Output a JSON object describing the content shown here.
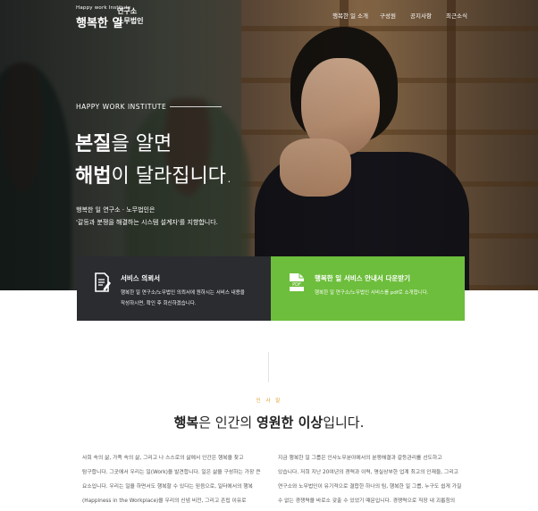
{
  "brand": {
    "tagline": "Happy work Institute",
    "name": "행복한 일",
    "sub1": "연구소",
    "sub2": "노무법인"
  },
  "nav": {
    "items": [
      {
        "label": "행복한 일 소개"
      },
      {
        "label": "구성원"
      },
      {
        "label": "공지사항"
      },
      {
        "label": "최근소식"
      }
    ]
  },
  "hero": {
    "eyebrow": "HAPPY WORK INSTITUTE",
    "headline1_bold": "본질",
    "headline1_rest": "을 알면",
    "headline2_bold": "해법",
    "headline2_rest": "이 달라집니다.",
    "desc1": "행복한 일 연구소 · 노무법인은",
    "desc2": "'갈등과 분쟁을 해결하는 시스템 설계자'를 지향합니다."
  },
  "cta": {
    "service": {
      "title": "서비스 의뢰서",
      "desc1": "행복한 일 연구소/노무법인 의뢰서에 원하시는 서비스 내용을",
      "desc2": "작성하시면, 확인 후 회신하겠습니다.",
      "icon": "document-pen-icon"
    },
    "download": {
      "title": "행복한 일 서비스 안내서 다운받기",
      "desc1": "행복한 일 연구소/노무법인 서비스를 pdf로 소개합니다.",
      "icon": "pdf-file-icon"
    }
  },
  "greeting": {
    "label": "인 사 말",
    "title_bold1": "행복",
    "title_mid": "은 인간의 ",
    "title_bold2": "영원한 이상",
    "title_end": "입니다.",
    "left_lines": [
      "사회 속의 삶, 가족 속의 삶, 그리고 나 스스로의 삶에서 인간은 행복을 찾고",
      "탐구합니다. 그곳에서 우리는 일(Work)을 발견합니다. 일은 삶을 구성하는 가장 큰",
      "요소입니다. 우리는 일을 하면서도 행복할 수 있다는 믿음으로, 일터에서의 행복",
      "(Happiness in the Workplace)을 우리의 신념 비전, 그리고 존립 이유로"
    ],
    "right_lines": [
      "지금 행복한 일 그룹은 인사노무분야에서의 분쟁해결과 갈등관리를 선도하고",
      "있습니다. 저희 지난 20여년의 경력과 이력, 명실상부한 업계 최고의 인재들, 그리고",
      "연구소와 노무법인이 유기적으로 결합한 하나의 팀, 행복한 일 그룹, 누구도 쉽게 가질",
      "수 없는 경쟁력을 바로소 갖출 수 있었기 때문입니다. 경쟁력으로 직장 내 괴롭힘의"
    ]
  },
  "colors": {
    "accent_green": "#6dbe3c",
    "dark_box": "#2a2c30",
    "label_orange": "#e0a030"
  }
}
